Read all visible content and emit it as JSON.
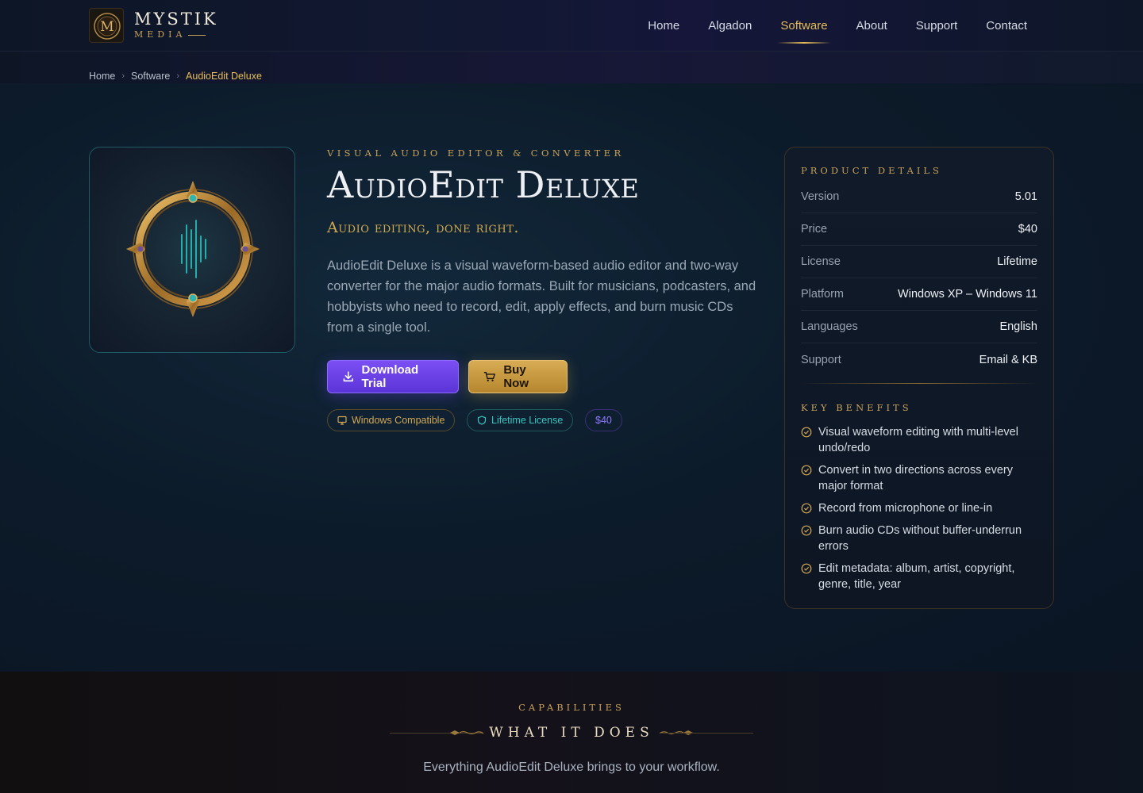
{
  "brand": {
    "name": "MYSTIK",
    "sub": "MEDIA"
  },
  "nav": {
    "items": [
      "Home",
      "Algadon",
      "Software",
      "About",
      "Support",
      "Contact"
    ],
    "active": "Software"
  },
  "breadcrumb": {
    "items": [
      "Home",
      "Software",
      "AudioEdit Deluxe"
    ]
  },
  "hero": {
    "eyebrow": "VISUAL AUDIO EDITOR & CONVERTER",
    "title": "AudioEdit Deluxe",
    "tagline": "Audio editing, done right.",
    "description": "AudioEdit Deluxe is a visual waveform-based audio editor and two-way converter for the major audio formats. Built for musicians, podcasters, and hobbyists who need to record, edit, apply effects, and burn music CDs from a single tool.",
    "download_label": "Download Trial",
    "buy_label": "Buy Now",
    "pills": [
      "Windows Compatible",
      "Lifetime License",
      "$40"
    ]
  },
  "details": {
    "heading": "PRODUCT DETAILS",
    "rows": [
      {
        "label": "Version",
        "value": "5.01"
      },
      {
        "label": "Price",
        "value": "$40"
      },
      {
        "label": "License",
        "value": "Lifetime"
      },
      {
        "label": "Platform",
        "value": "Windows XP – Windows 11"
      },
      {
        "label": "Languages",
        "value": "English"
      },
      {
        "label": "Support",
        "value": "Email & KB"
      }
    ],
    "benefits_heading": "KEY BENEFITS",
    "benefits": [
      "Visual waveform editing with multi-level undo/redo",
      "Convert in two directions across every major format",
      "Record from microphone or line-in",
      "Burn audio CDs without buffer-underrun errors",
      "Edit metadata: album, artist, copyright, genre, title, year"
    ]
  },
  "capabilities": {
    "eyebrow": "CAPABILITIES",
    "title": "WHAT IT DOES",
    "subtitle": "Everything AudioEdit Deluxe brings to your workflow."
  },
  "colors": {
    "accent_gold": "#e6bd57",
    "accent_purple": "#6b44ea",
    "accent_teal": "#38c6c0",
    "bg": "#0b1524"
  }
}
